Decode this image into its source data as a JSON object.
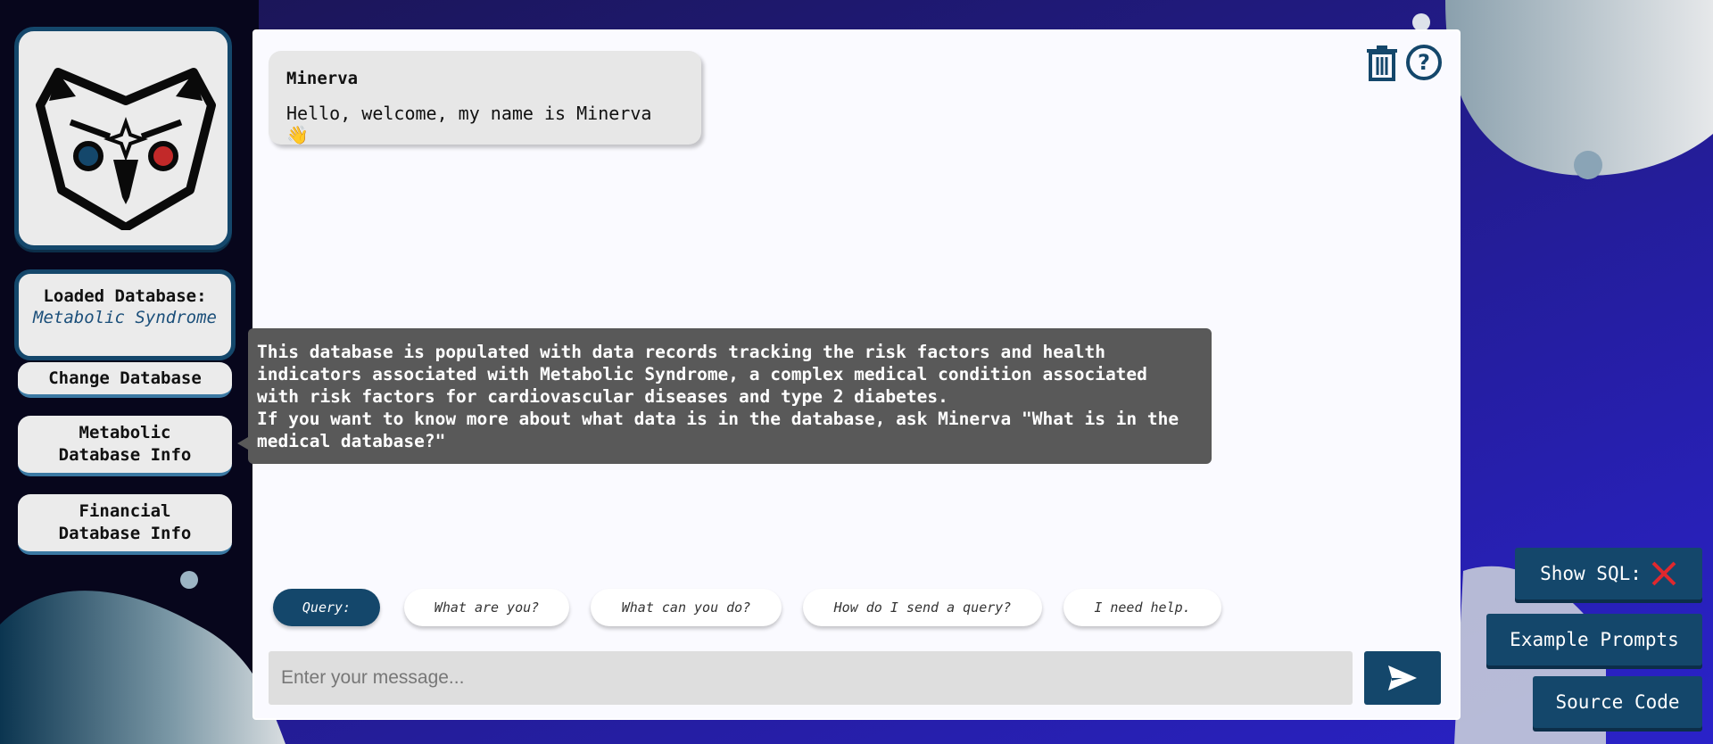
{
  "sidebar": {
    "logo_icon": "owl-logo-icon",
    "loaded_db_label": "Loaded Database:",
    "loaded_db_value": "Metabolic Syndrome",
    "change_db_label": "Change Database",
    "metabolic_info_label": "Metabolic\nDatabase Info",
    "financial_info_label": "Financial\nDatabase Info"
  },
  "chat": {
    "message": {
      "author": "Minerva",
      "text": "Hello, welcome, my name is Minerva 👋"
    },
    "icons": {
      "clear": "trash-icon",
      "help": "help-icon"
    },
    "chips": [
      {
        "label": "Query:"
      },
      {
        "label": "What are you?"
      },
      {
        "label": "What can you do?"
      },
      {
        "label": "How do I send a query?"
      },
      {
        "label": "I need help."
      }
    ],
    "input_placeholder": "Enter your message...",
    "send_icon": "send-icon"
  },
  "tooltip": {
    "text": "This database is populated with data records tracking the risk factors and health\nindicators associated with Metabolic Syndrome, a complex medical condition associated\nwith risk factors for cardiovascular diseases and type 2 diabetes.\nIf you want to know more about what data is in the database, ask Minerva \"What is in the\nmedical database?\""
  },
  "actions": {
    "show_sql_label": "Show SQL:",
    "show_sql_state_icon": "x-mark-icon",
    "example_prompts_label": "Example Prompts",
    "source_code_label": "Source Code"
  },
  "colors": {
    "accent": "#14476b",
    "background": "#2a22c9",
    "tooltip": "#595959",
    "red_x": "#e0282e"
  }
}
